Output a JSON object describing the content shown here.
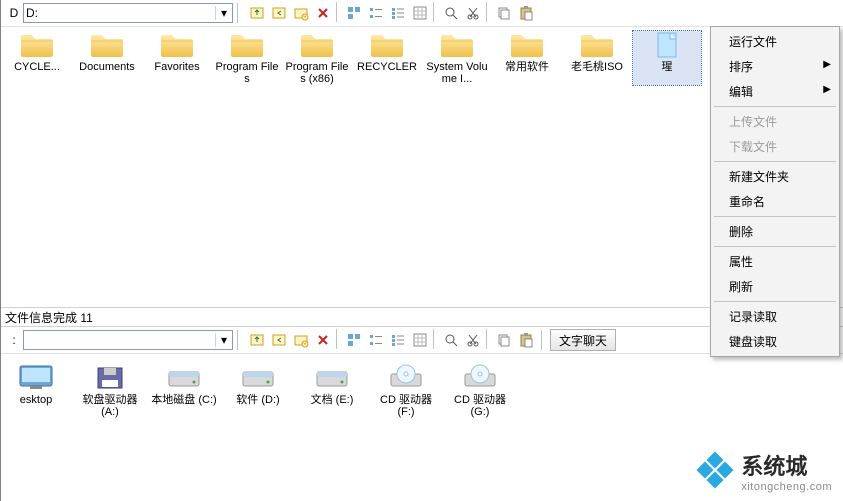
{
  "addr1": {
    "label": "D",
    "path": "D:"
  },
  "addr2": {
    "label": ":",
    "path": ""
  },
  "top_items": [
    {
      "label": "CYCLE...",
      "type": "folder"
    },
    {
      "label": "Documents",
      "type": "folder"
    },
    {
      "label": "Favorites",
      "type": "folder"
    },
    {
      "label": "Program Files",
      "type": "folder"
    },
    {
      "label": "Program Files (x86)",
      "type": "folder"
    },
    {
      "label": "RECYCLER",
      "type": "folder"
    },
    {
      "label": "System Volume I...",
      "type": "folder"
    },
    {
      "label": "常用软件",
      "type": "folder"
    },
    {
      "label": "老毛桃ISO",
      "type": "folder"
    },
    {
      "label": "瑆",
      "type": "file",
      "selected": true
    },
    {
      "label": "",
      "type": "cfg"
    }
  ],
  "context_menu": [
    {
      "label": "运行文件",
      "enabled": true
    },
    {
      "label": "排序",
      "enabled": true,
      "sub": true
    },
    {
      "label": "编辑",
      "enabled": true,
      "sub": true
    },
    {
      "sep": true
    },
    {
      "label": "上传文件",
      "enabled": false
    },
    {
      "label": "下载文件",
      "enabled": false
    },
    {
      "sep": true
    },
    {
      "label": "新建文件夹",
      "enabled": true
    },
    {
      "label": "重命名",
      "enabled": true
    },
    {
      "sep": true
    },
    {
      "label": "删除",
      "enabled": true
    },
    {
      "sep": true
    },
    {
      "label": "属性",
      "enabled": true
    },
    {
      "label": "刷新",
      "enabled": true
    },
    {
      "sep": true
    },
    {
      "label": "记录读取",
      "enabled": true
    },
    {
      "label": "键盘读取",
      "enabled": true
    }
  ],
  "status_text": "文件信息完成 11",
  "chat_button": "文字聊天",
  "drives": [
    {
      "label": "esktop",
      "type": "desktop"
    },
    {
      "label": "软盘驱动器 (A:)",
      "type": "floppy"
    },
    {
      "label": "本地磁盘 (C:)",
      "type": "hdd"
    },
    {
      "label": "软件 (D:)",
      "type": "hdd"
    },
    {
      "label": "文档 (E:)",
      "type": "hdd"
    },
    {
      "label": "CD 驱动器 (F:)",
      "type": "cd"
    },
    {
      "label": "CD 驱动器 (G:)",
      "type": "cd"
    }
  ],
  "watermark": {
    "cn": "系统城",
    "en": "xitongcheng.com"
  }
}
